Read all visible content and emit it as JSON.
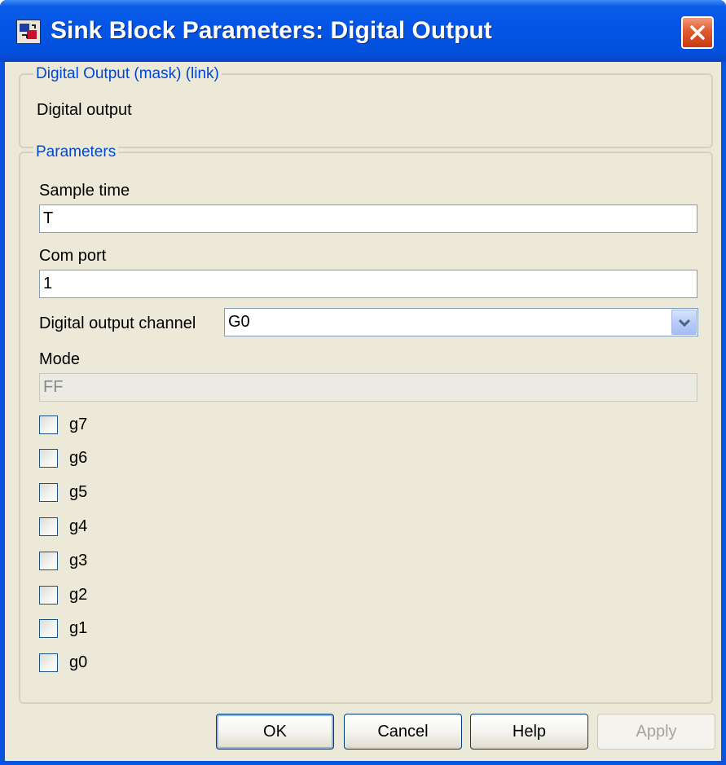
{
  "window": {
    "title": "Sink Block Parameters: Digital Output"
  },
  "description_group": {
    "legend": "Digital Output (mask) (link)",
    "text": "Digital output"
  },
  "parameters_group": {
    "legend": "Parameters",
    "sample_time": {
      "label": "Sample time",
      "value": "T"
    },
    "com_port": {
      "label": "Com port",
      "value": "1"
    },
    "digital_output_channel": {
      "label": "Digital output channel",
      "selected": "G0"
    },
    "mode": {
      "label": "Mode",
      "value": "FF"
    },
    "checkboxes": [
      {
        "label": "g7",
        "checked": false
      },
      {
        "label": "g6",
        "checked": false
      },
      {
        "label": "g5",
        "checked": false
      },
      {
        "label": "g4",
        "checked": false
      },
      {
        "label": "g3",
        "checked": false
      },
      {
        "label": "g2",
        "checked": false
      },
      {
        "label": "g1",
        "checked": false
      },
      {
        "label": "g0",
        "checked": false
      }
    ]
  },
  "buttons": {
    "ok": "OK",
    "cancel": "Cancel",
    "help": "Help",
    "apply": "Apply"
  },
  "colors": {
    "titlebar": "#0455e6",
    "dialog_face": "#ece9d8",
    "legend_text": "#0046d5",
    "close_button": "#e05a30"
  },
  "icons": {
    "app": "simulink-block-icon",
    "close": "close-icon",
    "dropdown": "chevron-down-icon"
  }
}
